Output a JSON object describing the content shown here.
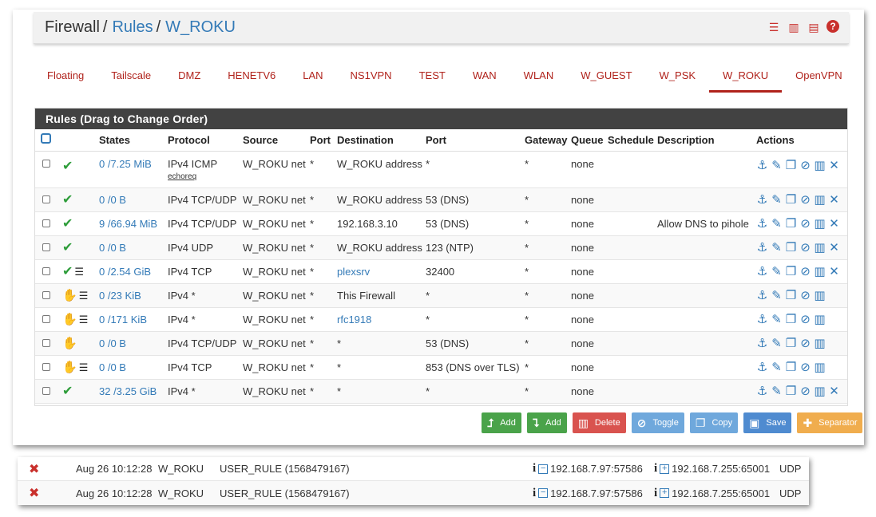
{
  "breadcrumb": {
    "firewall": "Firewall",
    "rules": "Rules",
    "iface": "W_ROKU",
    "sep": "/"
  },
  "tabs": [
    "Floating",
    "Tailscale",
    "DMZ",
    "HENETV6",
    "LAN",
    "NS1VPN",
    "TEST",
    "WAN",
    "WLAN",
    "W_GUEST",
    "W_PSK",
    "W_ROKU",
    "OpenVPN"
  ],
  "active_tab": "W_ROKU",
  "rules_title": "Rules (Drag to Change Order)",
  "columns": {
    "states": "States",
    "protocol": "Protocol",
    "source": "Source",
    "port": "Port",
    "destination": "Destination",
    "dport": "Port",
    "gateway": "Gateway",
    "queue": "Queue",
    "schedule": "Schedule",
    "description": "Description",
    "actions": "Actions"
  },
  "rows": [
    {
      "states": "0 /7.25 MiB",
      "protocol": "IPv4 ICMP",
      "sub": "echoreq",
      "source": "W_ROKU net",
      "port": "*",
      "destination": "W_ROKU address",
      "dport": "*",
      "gateway": "*",
      "queue": "none",
      "description": ""
    },
    {
      "states": "0 /0 B",
      "protocol": "IPv4 TCP/UDP",
      "sub": "",
      "source": "W_ROKU net",
      "port": "*",
      "destination": "W_ROKU address",
      "dport": "53 (DNS)",
      "gateway": "*",
      "queue": "none",
      "description": ""
    },
    {
      "states": "9 /66.94 MiB",
      "protocol": "IPv4 TCP/UDP",
      "sub": "",
      "source": "W_ROKU net",
      "port": "*",
      "destination": "192.168.3.10",
      "dport": "53 (DNS)",
      "gateway": "*",
      "queue": "none",
      "description": "Allow DNS to pihole"
    },
    {
      "states": "0 /0 B",
      "protocol": "IPv4 UDP",
      "sub": "",
      "source": "W_ROKU net",
      "port": "*",
      "destination": "W_ROKU address",
      "dport": "123 (NTP)",
      "gateway": "*",
      "queue": "none",
      "description": ""
    },
    {
      "states": "0 /2.54 GiB",
      "protocol": "IPv4 TCP",
      "sub": "",
      "source": "W_ROKU net",
      "port": "*",
      "destination": "plexsrv",
      "dport": "32400",
      "gateway": "*",
      "queue": "none",
      "description": ""
    },
    {
      "states": "0 /23 KiB",
      "protocol": "IPv4 *",
      "sub": "",
      "source": "W_ROKU net",
      "port": "*",
      "destination": "This Firewall",
      "dport": "*",
      "gateway": "*",
      "queue": "none",
      "description": ""
    },
    {
      "states": "0 /171 KiB",
      "protocol": "IPv4 *",
      "sub": "",
      "source": "W_ROKU net",
      "port": "*",
      "destination": "rfc1918",
      "dport": "*",
      "gateway": "*",
      "queue": "none",
      "description": ""
    },
    {
      "states": "0 /0 B",
      "protocol": "IPv4 TCP/UDP",
      "sub": "",
      "source": "W_ROKU net",
      "port": "*",
      "destination": "*",
      "dport": "53 (DNS)",
      "gateway": "*",
      "queue": "none",
      "description": ""
    },
    {
      "states": "0 /0 B",
      "protocol": "IPv4 TCP",
      "sub": "",
      "source": "W_ROKU net",
      "port": "*",
      "destination": "*",
      "dport": "853 (DNS over TLS)",
      "gateway": "*",
      "queue": "none",
      "description": ""
    },
    {
      "states": "32 /3.25 GiB",
      "protocol": "IPv4 *",
      "sub": "",
      "source": "W_ROKU net",
      "port": "*",
      "destination": "*",
      "dport": "*",
      "gateway": "*",
      "queue": "none",
      "description": ""
    }
  ],
  "buttons": {
    "add_top": "Add",
    "add_bottom": "Add",
    "delete": "Delete",
    "toggle": "Toggle",
    "copy": "Copy",
    "save": "Save",
    "separator": "Separator"
  },
  "log": [
    {
      "time": "Aug 26 10:12:28",
      "iface": "W_ROKU",
      "rule": "USER_RULE (1568479167)",
      "src": "192.168.7.97:57586",
      "dst": "192.168.7.255:65001",
      "proto": "UDP"
    },
    {
      "time": "Aug 26 10:12:28",
      "iface": "W_ROKU",
      "rule": "USER_RULE (1568479167)",
      "src": "192.168.7.97:57586",
      "dst": "192.168.7.255:65001",
      "proto": "UDP"
    }
  ],
  "colors": {
    "accent": "#b0221b",
    "link": "#337ab7",
    "header_bg": "#424242",
    "pass": "#2e9d3a",
    "match": "#e5a000"
  }
}
